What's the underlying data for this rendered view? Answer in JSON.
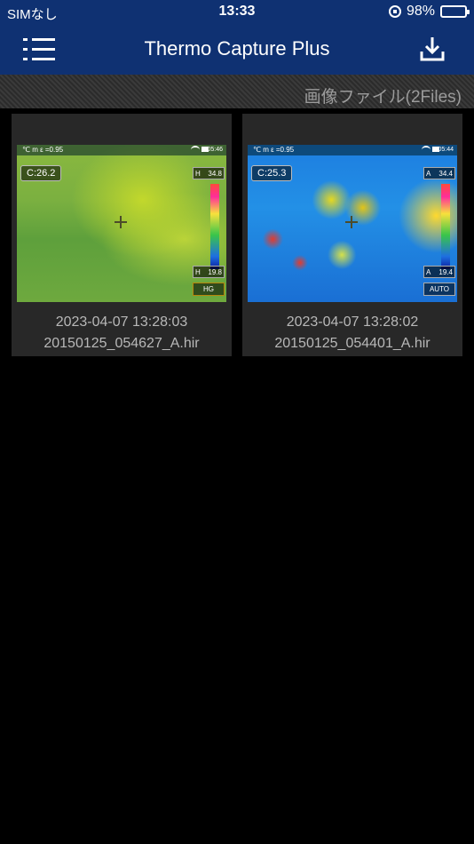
{
  "status": {
    "carrier": "SIMなし",
    "time": "13:33",
    "battery": "98%"
  },
  "nav": {
    "title": "Thermo Capture Plus"
  },
  "section": {
    "title": "画像ファイル(2Files)"
  },
  "files": [
    {
      "date": "2023-04-07 13:28:03",
      "name": "20150125_054627_A.hir",
      "overlay": {
        "top": "℃ m ε =0.95",
        "time": "05:46",
        "center_temp": "C:26.2",
        "high_label": "H",
        "high_value": "34.8",
        "low_label": "H",
        "low_value": "19.8",
        "mode": "HG"
      }
    },
    {
      "date": "2023-04-07 13:28:02",
      "name": "20150125_054401_A.hir",
      "overlay": {
        "top": "℃ m ε =0.95",
        "time": "05:44",
        "center_temp": "C:25.3",
        "high_label": "A",
        "high_value": "34.4",
        "low_label": "A",
        "low_value": "19.4",
        "mode": "AUTO"
      }
    }
  ],
  "colors": {
    "nav_bg": "#0f3172",
    "card_bg": "#282828",
    "meta_text": "#b8b8b8"
  },
  "icons": {
    "menu": "menu-list-icon",
    "download": "download-icon",
    "rotation_lock": "rotation-lock-icon",
    "battery": "battery-icon"
  }
}
